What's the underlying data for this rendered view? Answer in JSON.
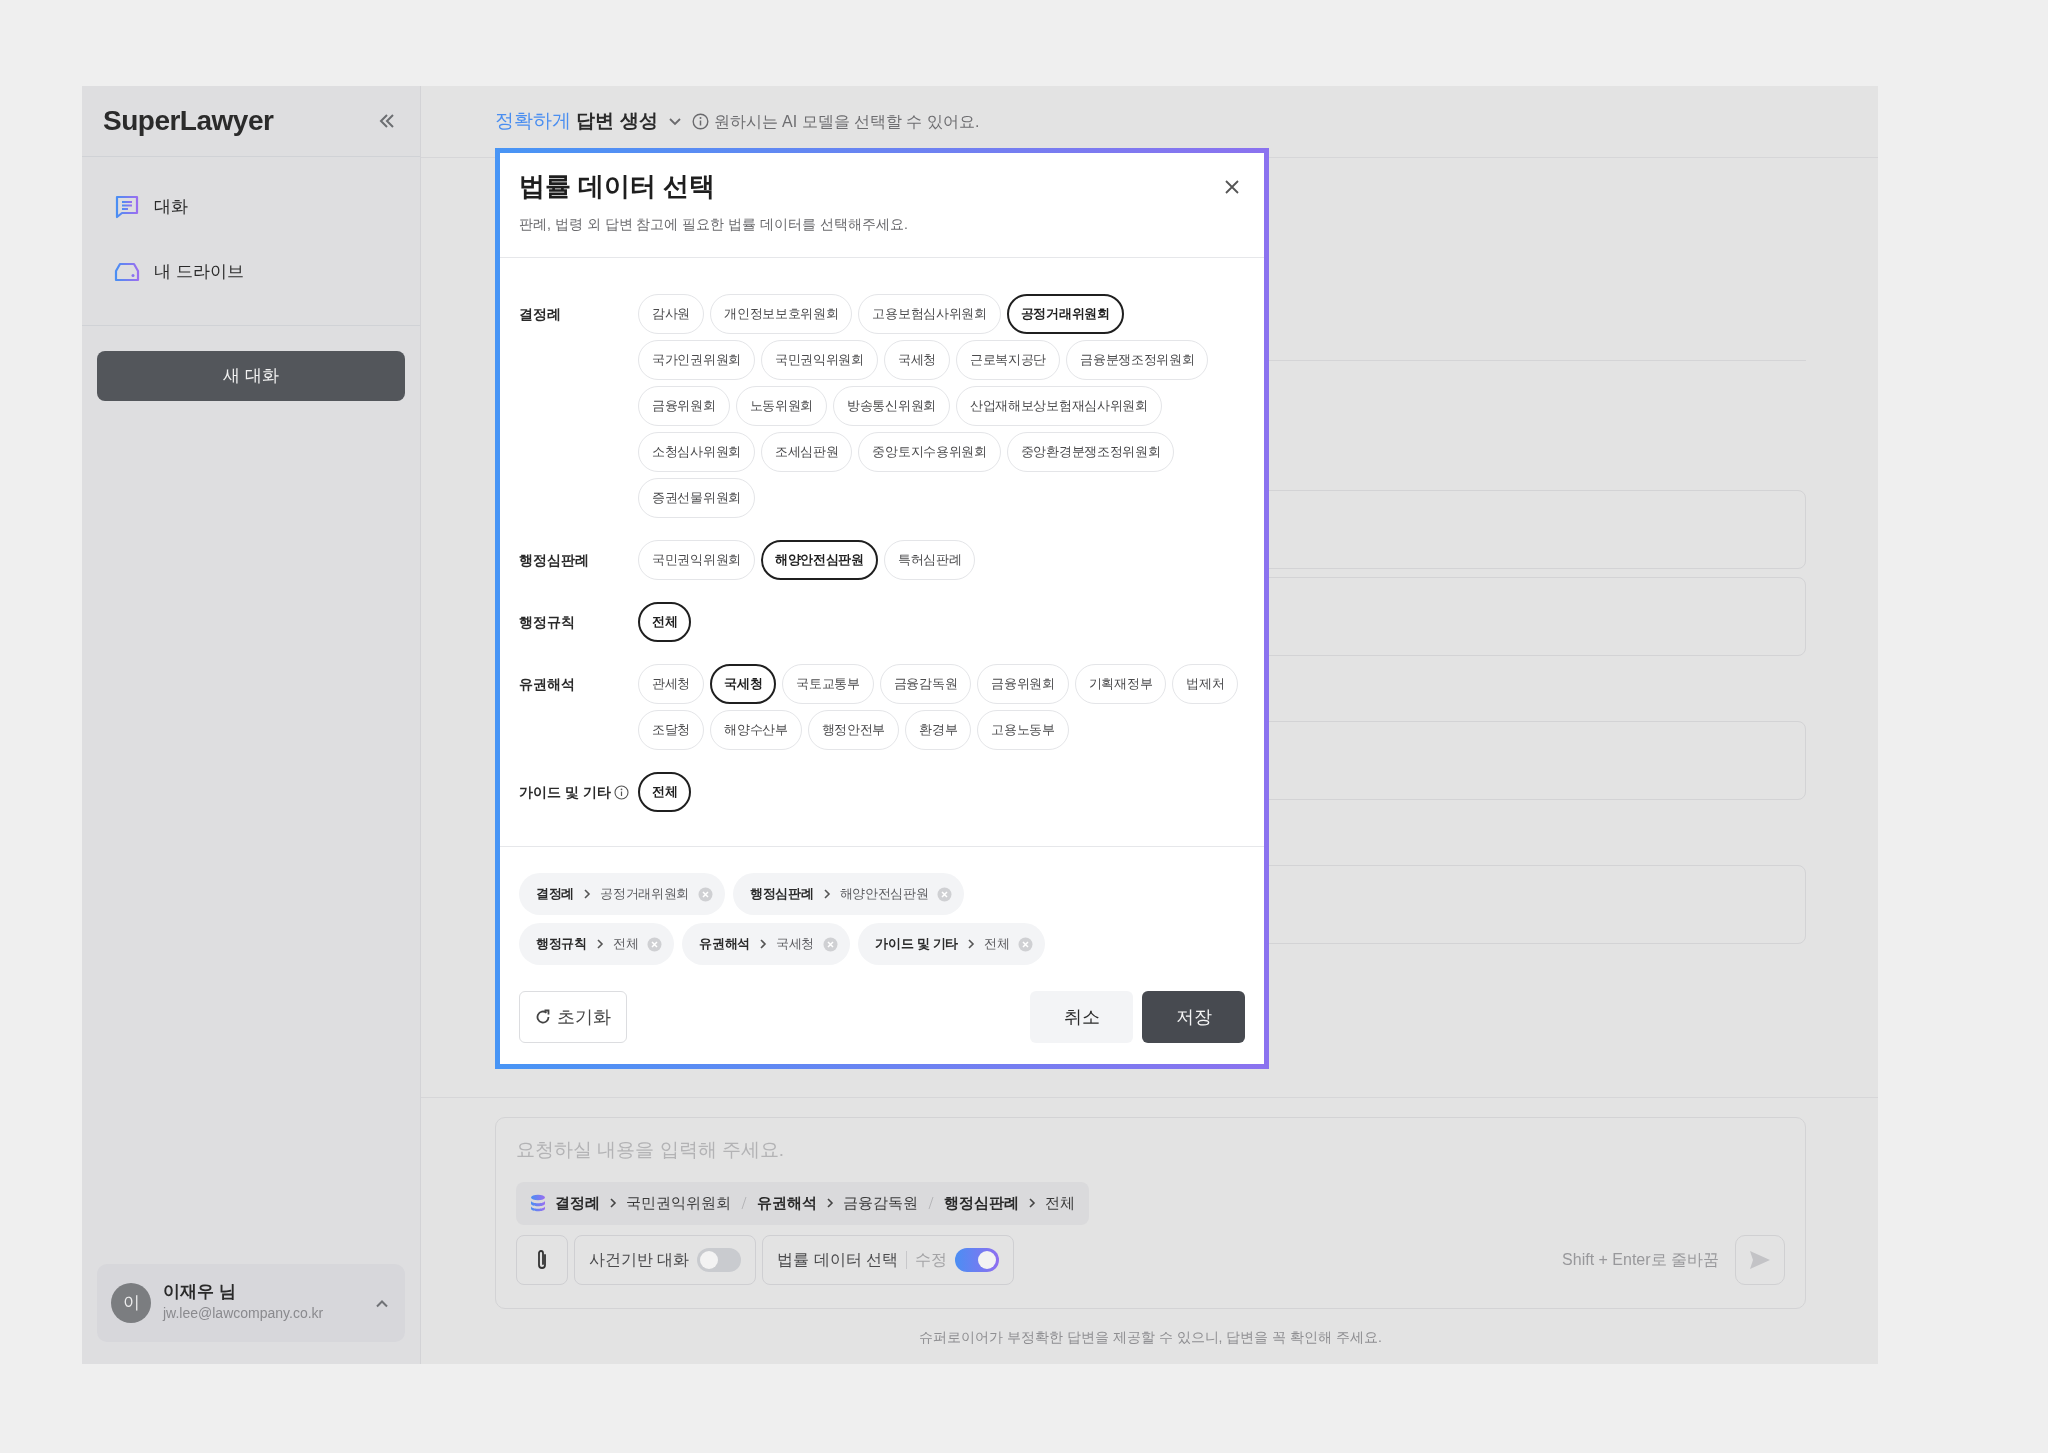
{
  "header": {
    "mode_highlight": "정확하게",
    "mode": "답변 생성",
    "hint": "원하시는 AI 모델을 선택할 수 있어요."
  },
  "sidebar": {
    "logo": "SuperLawyer",
    "items": [
      {
        "label": "대화",
        "kind": "chat"
      },
      {
        "label": "내 드라이브",
        "kind": "drive"
      }
    ],
    "new_chat": "새 대화",
    "user": {
      "avatar": "이",
      "name": "이재우 님",
      "email": "jw.lee@lawcompany.co.kr"
    }
  },
  "modal": {
    "title": "법률 데이터 선택",
    "subtitle": "판례, 법령 외 답변 참고에 필요한 법률 데이터를 선택해주세요.",
    "groups": [
      {
        "label": "결정례",
        "info": false,
        "options": [
          {
            "label": "감사원",
            "selected": false
          },
          {
            "label": "개인정보보호위원회",
            "selected": false
          },
          {
            "label": "고용보험심사위원회",
            "selected": false
          },
          {
            "label": "공정거래위원회",
            "selected": true
          },
          {
            "label": "국가인권위원회",
            "selected": false
          },
          {
            "label": "국민권익위원회",
            "selected": false
          },
          {
            "label": "국세청",
            "selected": false
          },
          {
            "label": "근로복지공단",
            "selected": false
          },
          {
            "label": "금융분쟁조정위원회",
            "selected": false
          },
          {
            "label": "금융위원회",
            "selected": false
          },
          {
            "label": "노동위원회",
            "selected": false
          },
          {
            "label": "방송통신위원회",
            "selected": false
          },
          {
            "label": "산업재해보상보험재심사위원회",
            "selected": false
          },
          {
            "label": "소청심사위원회",
            "selected": false
          },
          {
            "label": "조세심판원",
            "selected": false
          },
          {
            "label": "중앙토지수용위원회",
            "selected": false
          },
          {
            "label": "중앙환경분쟁조정위원회",
            "selected": false
          },
          {
            "label": "증권선물위원회",
            "selected": false
          }
        ]
      },
      {
        "label": "행정심판례",
        "info": false,
        "options": [
          {
            "label": "국민권익위원회",
            "selected": false
          },
          {
            "label": "해양안전심판원",
            "selected": true
          },
          {
            "label": "특허심판례",
            "selected": false
          }
        ]
      },
      {
        "label": "행정규칙",
        "info": false,
        "options": [
          {
            "label": "전체",
            "selected": true
          }
        ]
      },
      {
        "label": "유권해석",
        "info": false,
        "options": [
          {
            "label": "관세청",
            "selected": false
          },
          {
            "label": "국세청",
            "selected": true
          },
          {
            "label": "국토교통부",
            "selected": false
          },
          {
            "label": "금융감독원",
            "selected": false
          },
          {
            "label": "금융위원회",
            "selected": false
          },
          {
            "label": "기획재정부",
            "selected": false
          },
          {
            "label": "법제처",
            "selected": false
          },
          {
            "label": "조달청",
            "selected": false
          },
          {
            "label": "해양수산부",
            "selected": false
          },
          {
            "label": "행정안전부",
            "selected": false
          },
          {
            "label": "환경부",
            "selected": false
          },
          {
            "label": "고용노동부",
            "selected": false
          }
        ]
      },
      {
        "label": "가이드 및 기타",
        "info": true,
        "options": [
          {
            "label": "전체",
            "selected": true
          }
        ]
      }
    ],
    "summary": [
      {
        "group": "결정례",
        "value": "공정거래위원회"
      },
      {
        "group": "행정심판례",
        "value": "해양안전심판원"
      },
      {
        "group": "행정규칙",
        "value": "전체"
      },
      {
        "group": "유권해석",
        "value": "국세청"
      },
      {
        "group": "가이드 및 기타",
        "value": "전체"
      }
    ],
    "buttons": {
      "reset": "초기화",
      "cancel": "취소",
      "save": "저장"
    }
  },
  "composer": {
    "placeholder": "요청하실 내용을 입력해 주세요.",
    "filters": [
      {
        "group": "결정례",
        "value": "국민권익위원회"
      },
      {
        "group": "유권해석",
        "value": "금융감독원"
      },
      {
        "group": "행정심판례",
        "value": "전체"
      }
    ],
    "toggles": [
      {
        "label": "사건기반 대화",
        "on": false
      },
      {
        "label": "법률 데이터 선택",
        "extra": "수정",
        "on": true
      }
    ],
    "shortcut_hint": "Shift + Enter로 줄바꿈"
  },
  "disclaimer": "슈퍼로이어가 부정확한 답변을 제공할 수 있으니, 답변을 꼭 확인해 주세요."
}
